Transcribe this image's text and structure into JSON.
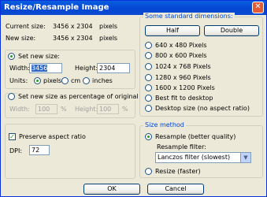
{
  "window": {
    "title": "Resize/Resample Image"
  },
  "size_info": {
    "current_label": "Current size:",
    "current_value": "3456  x  2304",
    "current_unit": "pixels",
    "new_label": "New size:",
    "new_value": "3456  x  2304",
    "new_unit": "pixels"
  },
  "set_new_size": {
    "label": "Set new size:",
    "width_label": "Width:",
    "width_value": "3456",
    "height_label": "Height:",
    "height_value": "2304",
    "units_label": "Units:",
    "units": [
      "pixels",
      "cm",
      "inches"
    ]
  },
  "percent": {
    "label": "Set new size as percentage of original",
    "width_label": "Width:",
    "width_value": "100",
    "height_label": "Height:",
    "height_value": "100",
    "unit": "%"
  },
  "aspect": {
    "preserve_label": "Preserve aspect ratio",
    "dpi_label": "DPI:",
    "dpi_value": "72"
  },
  "standard": {
    "legend": "Some standard dimensions:",
    "half": "Half",
    "double": "Double",
    "options": [
      "640 x 480 Pixels",
      "800 x 600 Pixels",
      "1024 x 768 Pixels",
      "1280 x 960 Pixels",
      "1600 x 1200 Pixels",
      "Best fit to desktop",
      "Desktop size (no aspect ratio)"
    ]
  },
  "method": {
    "legend": "Size method",
    "resample": "Resample (better quality)",
    "filter_label": "Resample filter:",
    "filter_value": "Lanczos filter (slowest)",
    "resize": "Resize (faster)"
  },
  "buttons": {
    "ok": "OK",
    "cancel": "Cancel"
  }
}
